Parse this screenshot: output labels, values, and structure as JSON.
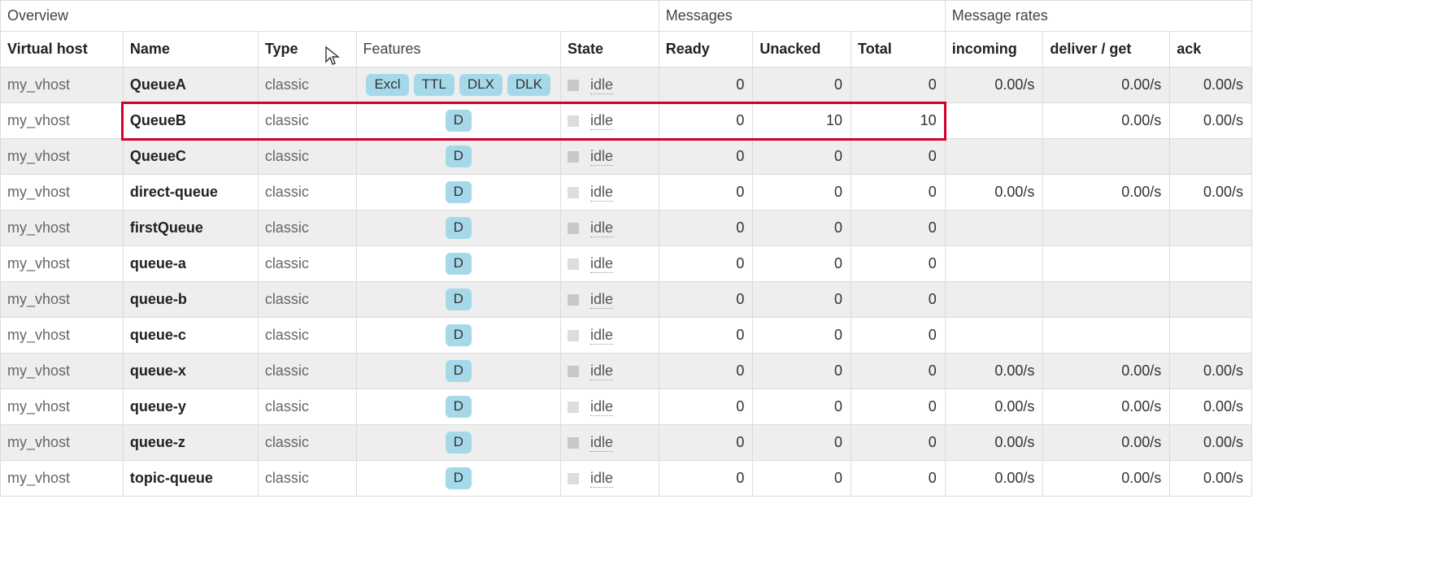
{
  "headers": {
    "group_overview": "Overview",
    "group_messages": "Messages",
    "group_rates": "Message rates",
    "vhost": "Virtual host",
    "name": "Name",
    "type": "Type",
    "features": "Features",
    "state": "State",
    "ready": "Ready",
    "unacked": "Unacked",
    "total": "Total",
    "incoming": "incoming",
    "deliver_get": "deliver / get",
    "ack": "ack"
  },
  "highlight_row_index": 1,
  "rows": [
    {
      "vhost": "my_vhost",
      "name": "QueueA",
      "type": "classic",
      "features": [
        "Excl",
        "TTL",
        "DLX",
        "DLK"
      ],
      "state": "idle",
      "ready": "0",
      "unacked": "0",
      "total": "0",
      "incoming": "0.00/s",
      "deliver_get": "0.00/s",
      "ack": "0.00/s"
    },
    {
      "vhost": "my_vhost",
      "name": "QueueB",
      "type": "classic",
      "features": [
        "D"
      ],
      "state": "idle",
      "ready": "0",
      "unacked": "10",
      "total": "10",
      "incoming": "",
      "deliver_get": "0.00/s",
      "ack": "0.00/s"
    },
    {
      "vhost": "my_vhost",
      "name": "QueueC",
      "type": "classic",
      "features": [
        "D"
      ],
      "state": "idle",
      "ready": "0",
      "unacked": "0",
      "total": "0",
      "incoming": "",
      "deliver_get": "",
      "ack": ""
    },
    {
      "vhost": "my_vhost",
      "name": "direct-queue",
      "type": "classic",
      "features": [
        "D"
      ],
      "state": "idle",
      "ready": "0",
      "unacked": "0",
      "total": "0",
      "incoming": "0.00/s",
      "deliver_get": "0.00/s",
      "ack": "0.00/s"
    },
    {
      "vhost": "my_vhost",
      "name": "firstQueue",
      "type": "classic",
      "features": [
        "D"
      ],
      "state": "idle",
      "ready": "0",
      "unacked": "0",
      "total": "0",
      "incoming": "",
      "deliver_get": "",
      "ack": ""
    },
    {
      "vhost": "my_vhost",
      "name": "queue-a",
      "type": "classic",
      "features": [
        "D"
      ],
      "state": "idle",
      "ready": "0",
      "unacked": "0",
      "total": "0",
      "incoming": "",
      "deliver_get": "",
      "ack": ""
    },
    {
      "vhost": "my_vhost",
      "name": "queue-b",
      "type": "classic",
      "features": [
        "D"
      ],
      "state": "idle",
      "ready": "0",
      "unacked": "0",
      "total": "0",
      "incoming": "",
      "deliver_get": "",
      "ack": ""
    },
    {
      "vhost": "my_vhost",
      "name": "queue-c",
      "type": "classic",
      "features": [
        "D"
      ],
      "state": "idle",
      "ready": "0",
      "unacked": "0",
      "total": "0",
      "incoming": "",
      "deliver_get": "",
      "ack": ""
    },
    {
      "vhost": "my_vhost",
      "name": "queue-x",
      "type": "classic",
      "features": [
        "D"
      ],
      "state": "idle",
      "ready": "0",
      "unacked": "0",
      "total": "0",
      "incoming": "0.00/s",
      "deliver_get": "0.00/s",
      "ack": "0.00/s"
    },
    {
      "vhost": "my_vhost",
      "name": "queue-y",
      "type": "classic",
      "features": [
        "D"
      ],
      "state": "idle",
      "ready": "0",
      "unacked": "0",
      "total": "0",
      "incoming": "0.00/s",
      "deliver_get": "0.00/s",
      "ack": "0.00/s"
    },
    {
      "vhost": "my_vhost",
      "name": "queue-z",
      "type": "classic",
      "features": [
        "D"
      ],
      "state": "idle",
      "ready": "0",
      "unacked": "0",
      "total": "0",
      "incoming": "0.00/s",
      "deliver_get": "0.00/s",
      "ack": "0.00/s"
    },
    {
      "vhost": "my_vhost",
      "name": "topic-queue",
      "type": "classic",
      "features": [
        "D"
      ],
      "state": "idle",
      "ready": "0",
      "unacked": "0",
      "total": "0",
      "incoming": "0.00/s",
      "deliver_get": "0.00/s",
      "ack": "0.00/s"
    }
  ]
}
